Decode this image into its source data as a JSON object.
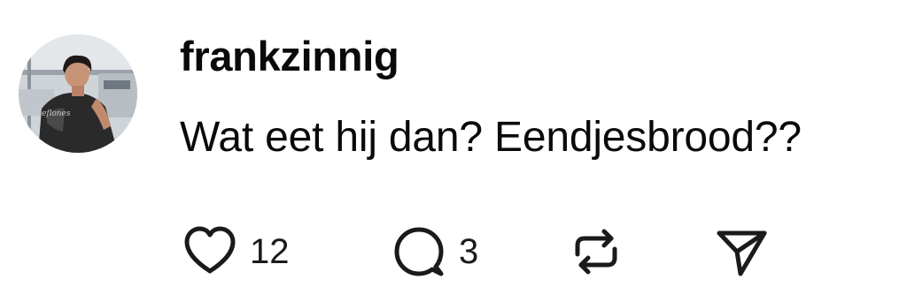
{
  "post": {
    "username": "frankzinnig",
    "text": "Wat eet hij dan? Eendjesbrood??",
    "avatar_icon": "profile-photo",
    "actions": {
      "like": {
        "icon": "heart-icon",
        "count": "12"
      },
      "reply": {
        "icon": "comment-icon",
        "count": "3"
      },
      "repost": {
        "icon": "repost-icon"
      },
      "share": {
        "icon": "send-icon"
      }
    }
  },
  "colors": {
    "text": "#0a0a0a",
    "icon": "#1a1a1a",
    "background": "#ffffff"
  }
}
